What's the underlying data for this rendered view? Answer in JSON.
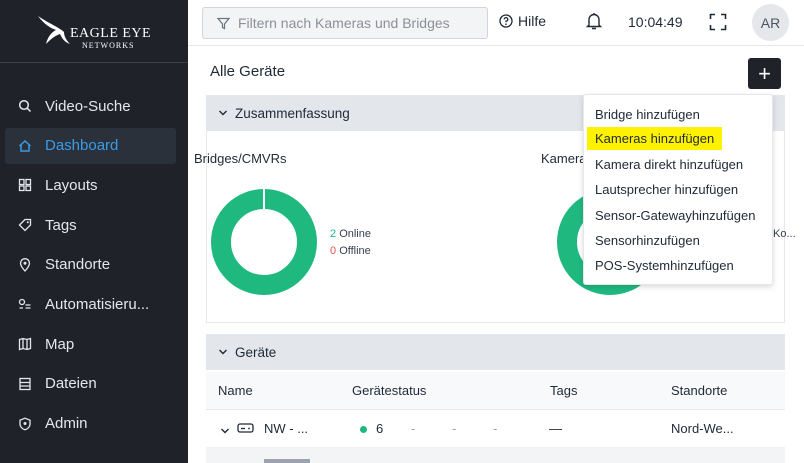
{
  "sidebar": {
    "logo_line1": "EAGLE EYE",
    "logo_line2": "NETWORKS",
    "items": [
      {
        "label": "Video-Suche",
        "icon": "search-icon"
      },
      {
        "label": "Dashboard",
        "icon": "home-icon",
        "active": true
      },
      {
        "label": "Layouts",
        "icon": "layouts-icon"
      },
      {
        "label": "Tags",
        "icon": "tag-icon"
      },
      {
        "label": "Standorte",
        "icon": "location-pin-icon"
      },
      {
        "label": "Automatisieru...",
        "icon": "automation-icon"
      },
      {
        "label": "Map",
        "icon": "map-icon"
      },
      {
        "label": "Dateien",
        "icon": "files-icon"
      },
      {
        "label": "Admin",
        "icon": "shield-icon"
      }
    ]
  },
  "topbar": {
    "search_placeholder": "Filtern nach Kameras und Bridges",
    "help_label": "Hilfe",
    "clock": "10:04:49",
    "avatar_initials": "AR"
  },
  "main": {
    "page_title": "Alle Geräte",
    "add_button": "+",
    "summary_header": "Zusammenfassung",
    "bridges_title": "Bridges/CMVRs",
    "bridges_online_count": "2",
    "bridges_online_label": "Online",
    "bridges_offline_count": "0",
    "bridges_offline_label": "Offline",
    "cameras_title_partial": "Kamera",
    "cameras_legend_partial": "Ko...",
    "devices_header": "Geräte"
  },
  "add_menu": {
    "items": [
      "Bridge hinzufügen",
      "Kameras hinzufügen",
      "Kamera direkt hinzufügen",
      "Lautsprecher hinzufügen",
      "Sensor-Gatewayhinzufügen",
      "Sensorhinzufügen",
      "POS-Systemhinzufügen"
    ],
    "highlighted_index": 1,
    "highlight_color": "#fff200"
  },
  "table": {
    "columns": [
      "Name",
      "Gerätestatus",
      "Tags",
      "Standorte"
    ],
    "rows": [
      {
        "name": "NW - ...",
        "status_count": "6",
        "dash1": "-",
        "dash2": "-",
        "dash3": "-",
        "tags": "—",
        "location": "Nord-We..."
      }
    ]
  },
  "colors": {
    "sidebar_bg": "#1f2329",
    "accent_blue": "#3b9be8",
    "online_green": "#1fb980",
    "offline_red": "#e2554f"
  }
}
